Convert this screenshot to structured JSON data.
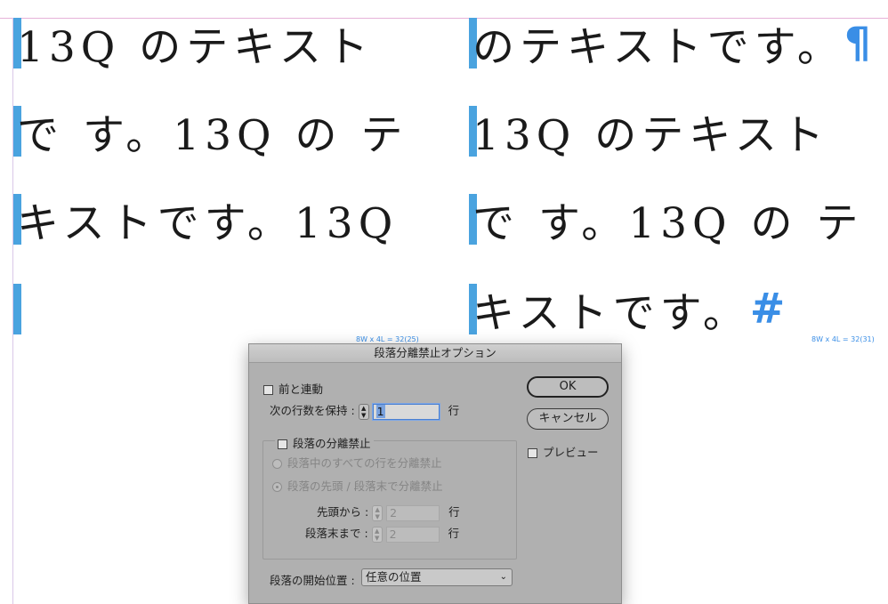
{
  "document": {
    "left_frame": {
      "rows": [
        "13Q のテキスト",
        "で す。13Q の テ",
        "キストです。13Q",
        ""
      ],
      "label": "8W x 4L = 32(25)"
    },
    "right_frame": {
      "rows": [
        "のテキストです。",
        "13Q のテキスト",
        "で す。13Q の テ",
        "キストです。"
      ],
      "row1_mark": "¶",
      "row4_mark": "#",
      "label": "8W x 4L = 32(31)"
    }
  },
  "dialog": {
    "title": "段落分離禁止オプション",
    "keep_with_previous": "前と連動",
    "keep_lines_label": "次の行数を保持 :",
    "keep_lines_value": "1",
    "line_unit": "行",
    "keep_lines_together": "段落の分離禁止",
    "all_lines_option": "段落中のすべての行を分離禁止",
    "start_end_option": "段落の先頭 / 段落末で分離禁止",
    "start_label": "先頭から :",
    "start_value": "2",
    "end_label": "段落末まで :",
    "end_value": "2",
    "start_paragraph_label": "段落の開始位置 :",
    "start_paragraph_value": "任意の位置",
    "ok_label": "OK",
    "cancel_label": "キャンセル",
    "preview_label": "プレビュー"
  }
}
